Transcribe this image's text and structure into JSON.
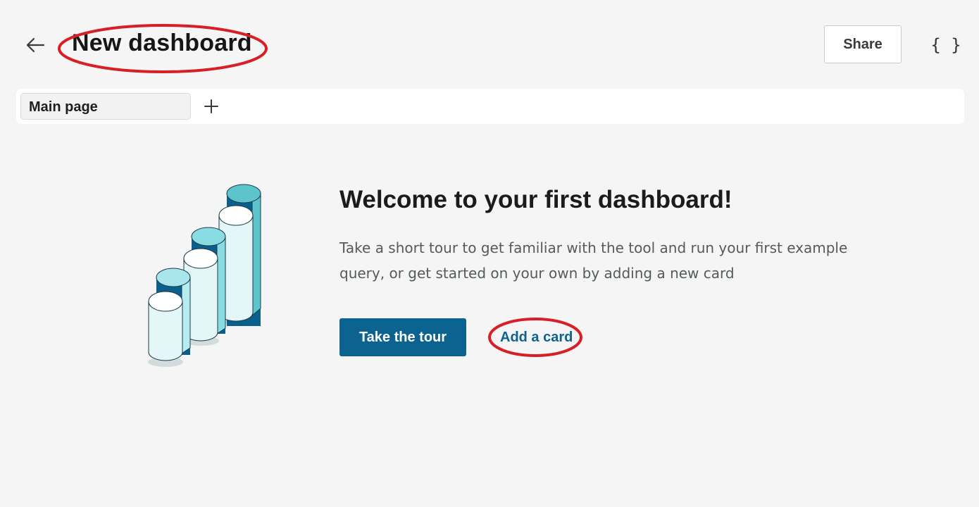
{
  "header": {
    "title": "New dashboard",
    "share_label": "Share",
    "code_label": "{ }"
  },
  "tabs": [
    {
      "label": "Main page",
      "selected": true
    }
  ],
  "empty_state": {
    "title": "Welcome to your first dashboard!",
    "description": "Take a short tour to get familiar with the tool and run your first example query, or get started on your own by adding a new card",
    "primary_button": "Take the tour",
    "secondary_link": "Add a card"
  },
  "icons": {
    "back": "arrow-left-icon",
    "add_tab": "plus-icon",
    "code": "braces-icon"
  },
  "colors": {
    "accent": "#0d6390",
    "annotation_ring": "#d81f26",
    "background": "#f4f5f4"
  }
}
